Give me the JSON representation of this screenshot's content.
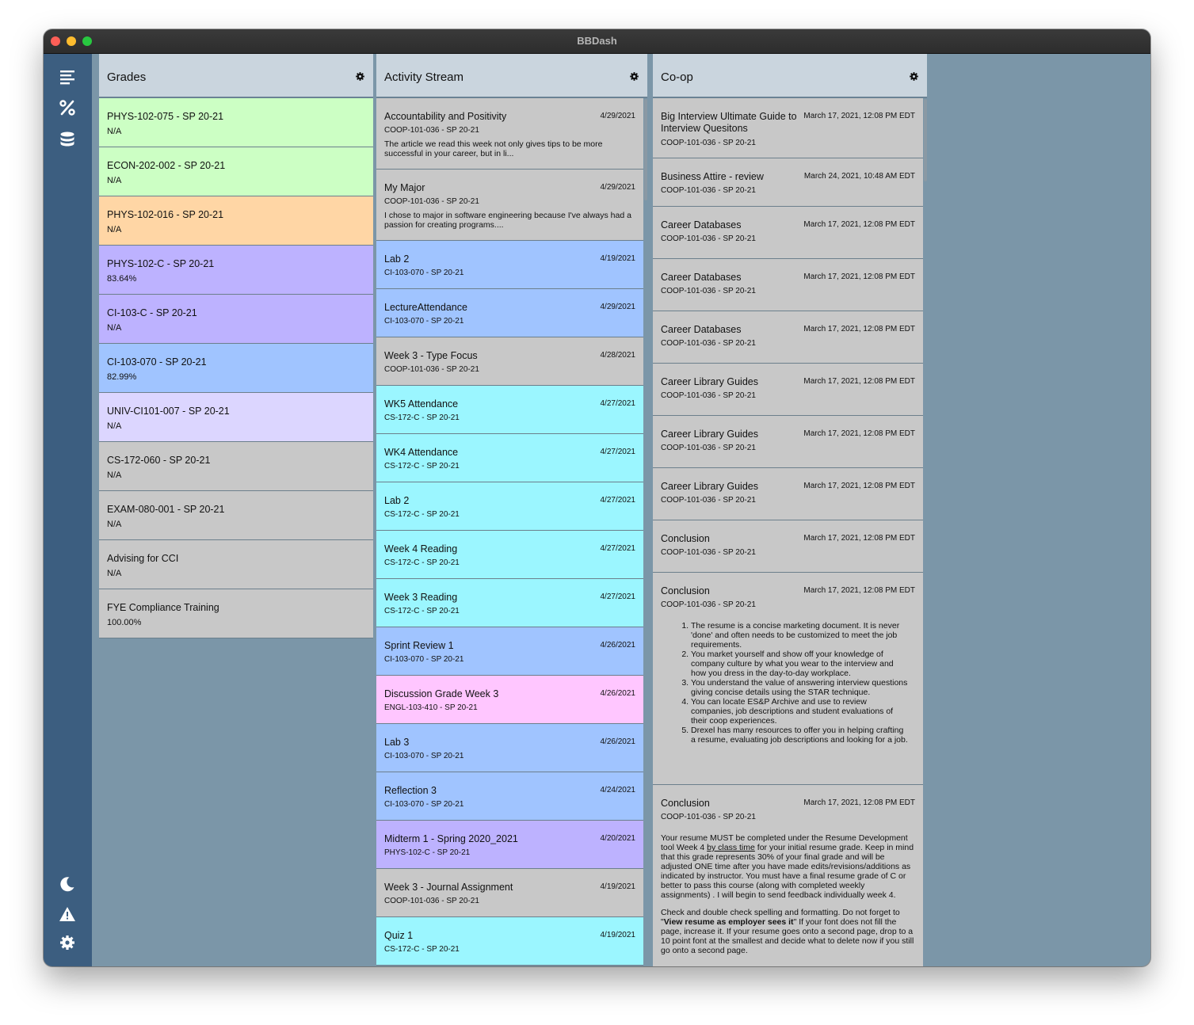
{
  "window": {
    "title": "BBDash"
  },
  "sidebar": {
    "top_icons": [
      "list-icon",
      "percent-icon",
      "database-icon"
    ],
    "bottom_icons": [
      "moon-icon",
      "warning-icon",
      "settings-icon"
    ]
  },
  "colors": {
    "green": "#ccffc4",
    "orange": "#ffd6a5",
    "purple": "#bdb2ff",
    "blue": "#a0c4ff",
    "lavender": "#dcd6ff",
    "gray": "#c8c8c8",
    "cyan": "#9bf6ff",
    "pink": "#ffc6ff"
  },
  "grades": {
    "title": "Grades",
    "items": [
      {
        "name": "PHYS-102-075 - SP 20-21",
        "value": "N/A",
        "color": "#ccffc4"
      },
      {
        "name": "ECON-202-002 - SP 20-21",
        "value": "N/A",
        "color": "#ccffc4"
      },
      {
        "name": "PHYS-102-016 - SP 20-21",
        "value": "N/A",
        "color": "#ffd6a5"
      },
      {
        "name": "PHYS-102-C - SP 20-21",
        "value": "83.64%",
        "color": "#bdb2ff"
      },
      {
        "name": "CI-103-C - SP 20-21",
        "value": "N/A",
        "color": "#bdb2ff"
      },
      {
        "name": "CI-103-070 - SP 20-21",
        "value": "82.99%",
        "color": "#a0c4ff"
      },
      {
        "name": "UNIV-CI101-007 - SP 20-21",
        "value": "N/A",
        "color": "#dcd6ff"
      },
      {
        "name": "CS-172-060 - SP 20-21",
        "value": "N/A",
        "color": "#c8c8c8"
      },
      {
        "name": "EXAM-080-001 - SP 20-21",
        "value": "N/A",
        "color": "#c8c8c8"
      },
      {
        "name": "Advising for CCI",
        "value": "N/A",
        "color": "#c8c8c8"
      },
      {
        "name": "FYE Compliance Training",
        "value": "100.00%",
        "color": "#c8c8c8"
      }
    ]
  },
  "activity": {
    "title": "Activity Stream",
    "items": [
      {
        "title": "Accountability and Positivity",
        "date": "4/29/2021",
        "course": "COOP-101-036 - SP 20-21",
        "snippet": "The article we read this week not only gives tips to be more successful in your career, but in li...",
        "color": "#c8c8c8"
      },
      {
        "title": "My Major",
        "date": "4/29/2021",
        "course": "COOP-101-036 - SP 20-21",
        "snippet": "I chose to major in software engineering because I've always had a passion for creating programs....",
        "color": "#c8c8c8"
      },
      {
        "title": "Lab 2",
        "date": "4/19/2021",
        "course": "CI-103-070 - SP 20-21",
        "snippet": "",
        "color": "#a0c4ff"
      },
      {
        "title": "LectureAttendance",
        "date": "4/29/2021",
        "course": "CI-103-070 - SP 20-21",
        "snippet": "",
        "color": "#a0c4ff"
      },
      {
        "title": "Week 3 - Type Focus",
        "date": "4/28/2021",
        "course": "COOP-101-036 - SP 20-21",
        "snippet": "",
        "color": "#c8c8c8"
      },
      {
        "title": "WK5 Attendance",
        "date": "4/27/2021",
        "course": "CS-172-C - SP 20-21",
        "snippet": "",
        "color": "#9bf6ff"
      },
      {
        "title": "WK4 Attendance",
        "date": "4/27/2021",
        "course": "CS-172-C - SP 20-21",
        "snippet": "",
        "color": "#9bf6ff"
      },
      {
        "title": "Lab 2",
        "date": "4/27/2021",
        "course": "CS-172-C - SP 20-21",
        "snippet": "",
        "color": "#9bf6ff"
      },
      {
        "title": "Week 4 Reading",
        "date": "4/27/2021",
        "course": "CS-172-C - SP 20-21",
        "snippet": "",
        "color": "#9bf6ff"
      },
      {
        "title": "Week 3 Reading",
        "date": "4/27/2021",
        "course": "CS-172-C - SP 20-21",
        "snippet": "",
        "color": "#9bf6ff"
      },
      {
        "title": "Sprint Review 1",
        "date": "4/26/2021",
        "course": "CI-103-070 - SP 20-21",
        "snippet": "",
        "color": "#a0c4ff"
      },
      {
        "title": "Discussion Grade Week 3",
        "date": "4/26/2021",
        "course": "ENGL-103-410 - SP 20-21",
        "snippet": "",
        "color": "#ffc6ff"
      },
      {
        "title": "Lab 3",
        "date": "4/26/2021",
        "course": "CI-103-070 - SP 20-21",
        "snippet": "",
        "color": "#a0c4ff"
      },
      {
        "title": "Reflection 3",
        "date": "4/24/2021",
        "course": "CI-103-070 - SP 20-21",
        "snippet": "",
        "color": "#a0c4ff"
      },
      {
        "title": "Midterm 1 - Spring 2020_2021",
        "date": "4/20/2021",
        "course": "PHYS-102-C - SP 20-21",
        "snippet": "",
        "color": "#bdb2ff"
      },
      {
        "title": "Week 3 - Journal Assignment",
        "date": "4/19/2021",
        "course": "COOP-101-036 - SP 20-21",
        "snippet": "",
        "color": "#c8c8c8"
      },
      {
        "title": "Quiz 1",
        "date": "4/19/2021",
        "course": "CS-172-C - SP 20-21",
        "snippet": "",
        "color": "#9bf6ff"
      }
    ]
  },
  "coop": {
    "title": "Co-op",
    "items": [
      {
        "title": "Big Interview Ultimate Guide to Interview Quesitons",
        "date": "March 17, 2021, 12:08 PM EDT",
        "course": "COOP-101-036 - SP 20-21"
      },
      {
        "title": "Business Attire - review",
        "date": "March 24, 2021, 10:48 AM EDT",
        "course": "COOP-101-036 - SP 20-21"
      },
      {
        "title": "Career Databases",
        "date": "March 17, 2021, 12:08 PM EDT",
        "course": "COOP-101-036 - SP 20-21"
      },
      {
        "title": "Career Databases",
        "date": "March 17, 2021, 12:08 PM EDT",
        "course": "COOP-101-036 - SP 20-21"
      },
      {
        "title": "Career Databases",
        "date": "March 17, 2021, 12:08 PM EDT",
        "course": "COOP-101-036 - SP 20-21"
      },
      {
        "title": "Career Library Guides",
        "date": "March 17, 2021, 12:08 PM EDT",
        "course": "COOP-101-036 - SP 20-21"
      },
      {
        "title": "Career Library Guides",
        "date": "March 17, 2021, 12:08 PM EDT",
        "course": "COOP-101-036 - SP 20-21"
      },
      {
        "title": "Career Library Guides",
        "date": "March 17, 2021, 12:08 PM EDT",
        "course": "COOP-101-036 - SP 20-21"
      },
      {
        "title": "Conclusion",
        "date": "March 17, 2021, 12:08 PM EDT",
        "course": "COOP-101-036 - SP 20-21"
      },
      {
        "title": "Conclusion",
        "date": "March 17, 2021, 12:08 PM EDT",
        "course": "COOP-101-036 - SP 20-21",
        "list": [
          "The resume is a concise marketing document. It is never 'done' and often needs to be customized to meet the job requirements.",
          "You market yourself and show off your knowledge of company culture by what you wear to the interview and how you dress in the day-to-day workplace.",
          "You understand the value of answering interview questions giving concise details using the STAR technique.",
          "You can locate ES&P Archive and use to review companies, job descriptions and student evaluations of their coop experiences.",
          "Drexel has many resources to offer you in helping crafting a resume, evaluating job descriptions and looking for a job."
        ]
      },
      {
        "title": "Conclusion",
        "date": "March 17, 2021, 12:08 PM EDT",
        "course": "COOP-101-036 - SP 20-21",
        "paragraphs": [
          {
            "before": "Your resume MUST be completed under the Resume Development tool Week 4 ",
            "link": "by class time",
            "after": " for your initial resume grade.  Keep in mind that this grade represents 30% of your final grade and will be adjusted ONE time after you have made edits/revisions/additions as indicated by instructor.  You must have a final resume grade of C or better to pass this course (along with completed weekly assignments) .  I will begin to send feedback individually week 4."
          },
          {
            "before": "Check and double check spelling and formatting. Do not forget to \"",
            "bold": "View resume as employer sees it",
            "after": "\"  If your font does not fill the page, increase it.  If your resume goes onto a second page, drop to a 10 point font at the smallest and decide what to delete now if you still go onto a  second page."
          }
        ]
      }
    ]
  }
}
